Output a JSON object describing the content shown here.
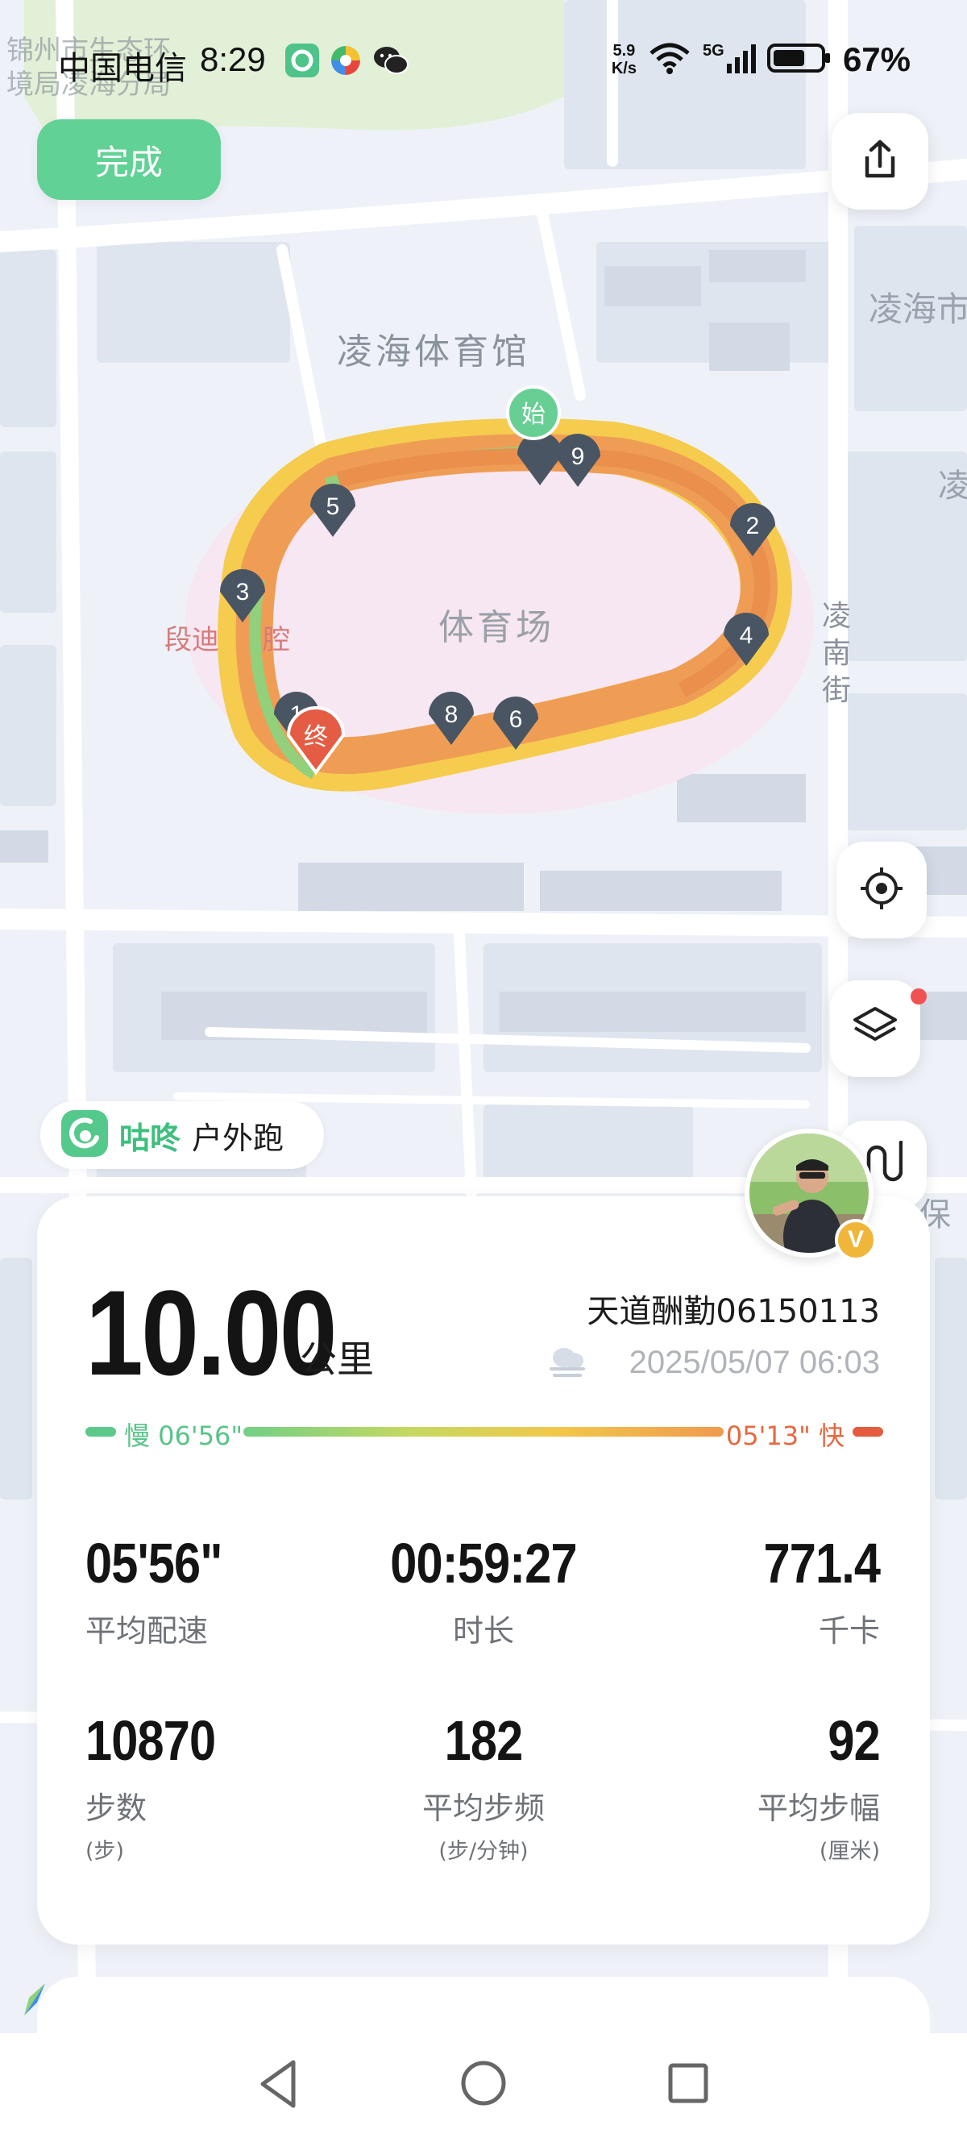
{
  "status_bar": {
    "carrier": "中国电信",
    "time": "8:29",
    "network_speed_value": "5.9",
    "network_speed_unit": "K/s",
    "battery": "67%",
    "ghost_overlay_line1": "锦州市生态环",
    "ghost_overlay_line2": "境局凌海分局",
    "icons": [
      "gudong-app-icon",
      "browser-app-icon",
      "wechat-icon",
      "wifi-icon",
      "signal-5g-icon",
      "battery-icon"
    ]
  },
  "top_actions": {
    "done_label": "完成",
    "share_icon": "share-icon"
  },
  "map": {
    "labels": {
      "gym": "凌海体育馆",
      "stadium": "体育场",
      "poi_left": "段迪",
      "poi_left2": "腔",
      "street": "凌南街",
      "top_right": "凌海市",
      "right_edge": "凌",
      "bottom_right": "保"
    },
    "start_marker": "始",
    "end_marker": "终",
    "km_markers": [
      "2",
      "3",
      "4",
      "5",
      "6",
      "8",
      "9",
      "1"
    ],
    "controls": [
      "locate-icon",
      "layers-icon",
      "route-icon"
    ],
    "colors": {
      "route_fast": "#ef9d55",
      "route_mid": "#f5cc4e",
      "route_slow": "#8fd17a",
      "marker": "#4a5563",
      "stadium_fill": "#f8e6f3",
      "road": "#ffffff",
      "block": "#d6dde8"
    }
  },
  "brand": {
    "name": "咕咚",
    "activity": "户外跑",
    "accent_color": "#3dbf7d"
  },
  "summary": {
    "distance": "10.00",
    "distance_unit": "公里",
    "user_name": "天道酬勤06150113",
    "datetime": "2025/05/07 06:03",
    "weather_icon": "cloudy-icon",
    "avatar_badge": "V",
    "pace_slow_label": "慢 06'56\"",
    "pace_fast_label": "05'13\" 快",
    "stats_row1": [
      {
        "value": "05'56\"",
        "label": "平均配速"
      },
      {
        "value": "00:59:27",
        "label": "时长"
      },
      {
        "value": "771.4",
        "label": "千卡"
      }
    ],
    "stats_row2": [
      {
        "value": "10870",
        "label": "步数",
        "unit": "(步)"
      },
      {
        "value": "182",
        "label": "平均步频",
        "unit": "(步/分钟)"
      },
      {
        "value": "92",
        "label": "平均步幅",
        "unit": "(厘米)"
      }
    ]
  },
  "nav_bar": {
    "buttons": [
      "back-icon",
      "home-icon",
      "recents-icon"
    ]
  }
}
